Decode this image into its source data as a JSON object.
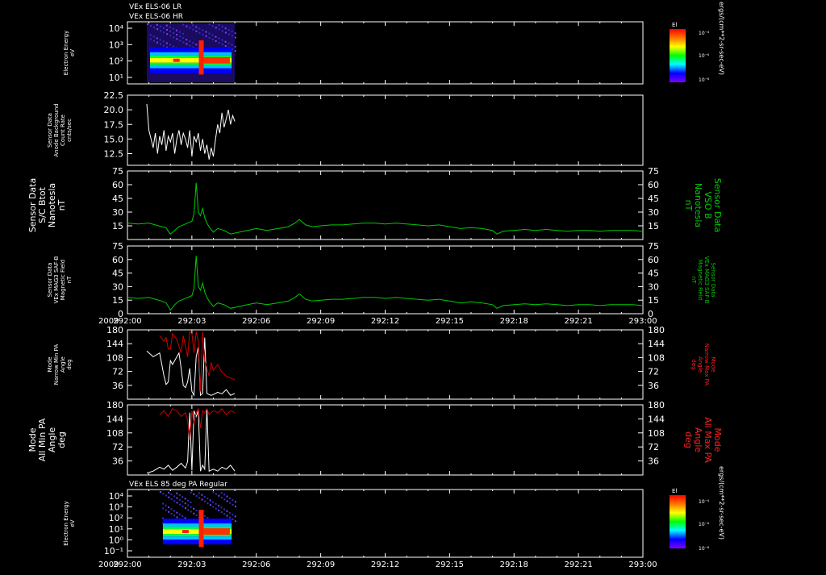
{
  "titles": {
    "top_line1": "VEx ELS-06 LR",
    "top_line2": "VEx ELS-06 HR",
    "bottom": "VEx ELS 85 deg PA Regular"
  },
  "time_axis": {
    "year": "2009",
    "ticks": [
      "292:00",
      "292:03",
      "292:06",
      "292:09",
      "292:12",
      "292:15",
      "292:18",
      "292:21",
      "293:00"
    ]
  },
  "colorbar": {
    "title": "El",
    "unit": "ergs/(cm**2-sr-sec-eV)",
    "labels": [
      "10⁻⁴",
      "10⁻⁶",
      "10⁻⁸"
    ],
    "colors": [
      "#ff0000",
      "#ff8000",
      "#ffff00",
      "#00ff00",
      "#00ffff",
      "#0000ff",
      "#8000ff"
    ]
  },
  "chart_data": [
    {
      "id": "els-hr-spectrogram",
      "type": "heatmap",
      "ylabel": [
        "Electron Energy",
        "eV"
      ],
      "yticks": [
        "10⁴",
        "10³",
        "10²",
        "10¹"
      ],
      "x_range": [
        "292:00:54",
        "292:05:00"
      ],
      "note_colormap": "El"
    },
    {
      "id": "anode-background",
      "type": "line",
      "ylabel": [
        "Sensor Data",
        "Anode Background",
        "Count Rate",
        "cnts/sec"
      ],
      "yticks": [
        "22.5",
        "20.0",
        "17.5",
        "15.0",
        "12.5"
      ],
      "ylim": [
        10.5,
        22.5
      ],
      "color": "#ffffff",
      "x": [
        0.9,
        1.0,
        1.1,
        1.2,
        1.3,
        1.4,
        1.5,
        1.6,
        1.7,
        1.8,
        1.9,
        2.0,
        2.1,
        2.2,
        2.3,
        2.4,
        2.5,
        2.6,
        2.7,
        2.8,
        2.9,
        3.0,
        3.1,
        3.2,
        3.3,
        3.4,
        3.5,
        3.6,
        3.7,
        3.8,
        3.9,
        4.0,
        4.1,
        4.2,
        4.3,
        4.4,
        4.5,
        4.6,
        4.7,
        4.8,
        4.9,
        5.0
      ],
      "y": [
        21.0,
        16.5,
        15.0,
        13.5,
        16.0,
        12.5,
        15.5,
        14.0,
        16.5,
        13.0,
        15.5,
        14.5,
        16.0,
        12.5,
        15.0,
        16.5,
        14.0,
        16.0,
        15.0,
        13.5,
        16.5,
        12.0,
        15.5,
        14.5,
        16.0,
        13.0,
        15.0,
        12.5,
        14.0,
        11.5,
        13.5,
        12.0,
        15.0,
        17.5,
        16.0,
        19.5,
        17.0,
        18.5,
        20.0,
        17.5,
        19.0,
        18.0
      ]
    },
    {
      "id": "btot",
      "type": "line",
      "ylabel": [
        "Sensor Data",
        "S/C Btot",
        "Nanotesla",
        "nT"
      ],
      "ylabel_right": [
        "Sensor Data",
        "VSO B",
        "Nanotesla",
        "nT"
      ],
      "yticks": [
        "75",
        "60",
        "45",
        "30",
        "15"
      ],
      "ylim": [
        0,
        75
      ],
      "color": "#00cc00",
      "x": [
        0,
        0.5,
        1.0,
        1.3,
        1.6,
        1.8,
        1.9,
        2.0,
        2.2,
        2.4,
        2.6,
        2.8,
        3.0,
        3.1,
        3.2,
        3.3,
        3.4,
        3.5,
        3.6,
        3.7,
        3.8,
        4.0,
        4.2,
        4.5,
        4.8,
        5.2,
        5.6,
        6.0,
        6.5,
        7.0,
        7.5,
        7.8,
        8.0,
        8.3,
        8.6,
        9.0,
        9.5,
        10.0,
        10.5,
        11.0,
        11.5,
        12.0,
        12.5,
        13.0,
        13.5,
        14.0,
        14.5,
        15.0,
        15.5,
        16.0,
        16.5,
        17.0,
        17.2,
        17.5,
        18.0,
        18.5,
        19.0,
        19.5,
        20.0,
        20.5,
        21.0,
        21.5,
        22.0,
        22.5,
        23.0,
        23.5,
        24.0
      ],
      "y": [
        18,
        17,
        18,
        16,
        14,
        13,
        9,
        6,
        10,
        14,
        16,
        18,
        20,
        28,
        62,
        30,
        26,
        34,
        24,
        18,
        14,
        8,
        12,
        10,
        6,
        8,
        10,
        12,
        10,
        12,
        14,
        18,
        22,
        16,
        14,
        15,
        16,
        16,
        17,
        18,
        18,
        17,
        18,
        17,
        16,
        15,
        16,
        14,
        12,
        13,
        12,
        10,
        6,
        9,
        10,
        11,
        10,
        11,
        10,
        9,
        10,
        10,
        9,
        10,
        10,
        10,
        9
      ]
    },
    {
      "id": "mag3-field",
      "type": "line",
      "ylabel": [
        "Sensor Data",
        "VEx MAG3 SAF-B",
        "Magnetic Field",
        "nT"
      ],
      "ylabel_right": [
        "Sensor Data",
        "VEx MAG3 SAF-B",
        "Magnetic Field",
        "nT"
      ],
      "yticks": [
        "75",
        "60",
        "45",
        "30",
        "15",
        "0"
      ],
      "ylim": [
        0,
        75
      ],
      "color": "#00cc00",
      "x": [
        0,
        0.5,
        1.0,
        1.3,
        1.6,
        1.8,
        1.9,
        2.0,
        2.2,
        2.4,
        2.6,
        2.8,
        3.0,
        3.1,
        3.2,
        3.3,
        3.4,
        3.5,
        3.6,
        3.7,
        3.8,
        4.0,
        4.2,
        4.5,
        4.8,
        5.2,
        5.6,
        6.0,
        6.5,
        7.0,
        7.5,
        7.8,
        8.0,
        8.3,
        8.6,
        9.0,
        9.5,
        10.0,
        10.5,
        11.0,
        11.5,
        12.0,
        12.5,
        13.0,
        13.5,
        14.0,
        14.5,
        15.0,
        15.5,
        16.0,
        16.5,
        17.0,
        17.2,
        17.5,
        18.0,
        18.5,
        19.0,
        19.5,
        20.0,
        20.5,
        21.0,
        21.5,
        22.0,
        22.5,
        23.0,
        23.5,
        24.0
      ],
      "y": [
        18,
        17,
        18,
        16,
        14,
        12,
        8,
        4,
        10,
        14,
        16,
        18,
        20,
        28,
        64,
        30,
        26,
        34,
        24,
        18,
        14,
        8,
        12,
        10,
        6,
        8,
        10,
        12,
        10,
        12,
        14,
        18,
        22,
        16,
        14,
        15,
        16,
        16,
        17,
        18,
        18,
        17,
        18,
        17,
        16,
        15,
        16,
        14,
        12,
        13,
        12,
        10,
        6,
        9,
        10,
        11,
        10,
        11,
        10,
        9,
        10,
        10,
        9,
        10,
        10,
        10,
        9
      ]
    },
    {
      "id": "narrow-pa",
      "type": "line",
      "ylabel": [
        "Mode",
        "Narrow Min PA",
        "Angle",
        "deg"
      ],
      "ylabel_right": [
        "Mode",
        "Narrow Max PA",
        "Angle",
        "deg"
      ],
      "yticks": [
        "180",
        "144",
        "108",
        "72",
        "36"
      ],
      "ylim": [
        0,
        180
      ],
      "series": [
        {
          "name": "Narrow Min PA",
          "color": "#ffffff",
          "x": [
            0.9,
            1.2,
            1.5,
            1.7,
            1.8,
            1.9,
            2.0,
            2.1,
            2.3,
            2.4,
            2.5,
            2.6,
            2.7,
            2.8,
            2.9,
            3.0,
            3.1,
            3.2,
            3.3,
            3.4,
            3.5,
            3.6,
            3.7,
            3.8,
            3.9,
            4.0,
            4.2,
            4.4,
            4.6,
            4.8,
            5.0
          ],
          "y": [
            125,
            110,
            120,
            60,
            38,
            45,
            100,
            90,
            110,
            120,
            80,
            36,
            30,
            45,
            80,
            20,
            10,
            110,
            135,
            10,
            15,
            160,
            15,
            12,
            10,
            12,
            18,
            14,
            25,
            10,
            15
          ]
        },
        {
          "name": "Narrow Max PA",
          "color": "#cc0000",
          "x": [
            1.5,
            1.7,
            1.8,
            1.9,
            2.0,
            2.1,
            2.3,
            2.5,
            2.6,
            2.8,
            2.9,
            3.0,
            3.1,
            3.2,
            3.3,
            3.4,
            3.5,
            3.6,
            3.7,
            3.8,
            3.9,
            4.0,
            4.2,
            4.4,
            4.6,
            4.8,
            5.0
          ],
          "y": [
            165,
            150,
            160,
            130,
            130,
            170,
            155,
            120,
            165,
            110,
            175,
            170,
            120,
            175,
            150,
            20,
            175,
            100,
            80,
            60,
            95,
            75,
            90,
            70,
            60,
            55,
            50
          ]
        }
      ]
    },
    {
      "id": "all-pa",
      "type": "line",
      "ylabel": [
        "Mode",
        "All Min PA",
        "Angle",
        "deg"
      ],
      "ylabel_right": [
        "Mode",
        "All Max PA",
        "Angle",
        "deg"
      ],
      "yticks": [
        "180",
        "144",
        "108",
        "72",
        "36"
      ],
      "ylim": [
        0,
        180
      ],
      "series": [
        {
          "name": "All Min PA",
          "color": "#ffffff",
          "x": [
            0.9,
            1.2,
            1.5,
            1.7,
            1.9,
            2.1,
            2.3,
            2.5,
            2.7,
            2.8,
            2.9,
            3.0,
            3.1,
            3.2,
            3.3,
            3.4,
            3.5,
            3.6,
            3.7,
            3.8,
            4.0,
            4.2,
            4.4,
            4.6,
            4.8,
            5.0
          ],
          "y": [
            5,
            10,
            20,
            15,
            25,
            12,
            20,
            30,
            18,
            35,
            160,
            12,
            165,
            150,
            165,
            10,
            25,
            15,
            170,
            10,
            15,
            10,
            20,
            15,
            25,
            10
          ]
        },
        {
          "name": "All Max PA",
          "color": "#cc0000",
          "x": [
            1.5,
            1.7,
            1.9,
            2.1,
            2.3,
            2.5,
            2.7,
            2.8,
            2.9,
            3.0,
            3.1,
            3.2,
            3.3,
            3.4,
            3.5,
            3.6,
            3.7,
            3.8,
            4.0,
            4.2,
            4.4,
            4.6,
            4.8,
            5.0
          ],
          "y": [
            155,
            165,
            150,
            170,
            165,
            150,
            160,
            140,
            90,
            165,
            130,
            160,
            170,
            120,
            165,
            160,
            170,
            155,
            165,
            160,
            170,
            155,
            165,
            160
          ]
        }
      ]
    },
    {
      "id": "els-85deg-spectrogram",
      "type": "heatmap",
      "ylabel": [
        "Electron Energy",
        "eV"
      ],
      "yticks": [
        "10⁴",
        "10³",
        "10²",
        "10¹",
        "10⁰",
        "10⁻¹"
      ],
      "x_range": [
        "292:01:30",
        "292:05:00"
      ],
      "note_colormap": "El"
    }
  ]
}
